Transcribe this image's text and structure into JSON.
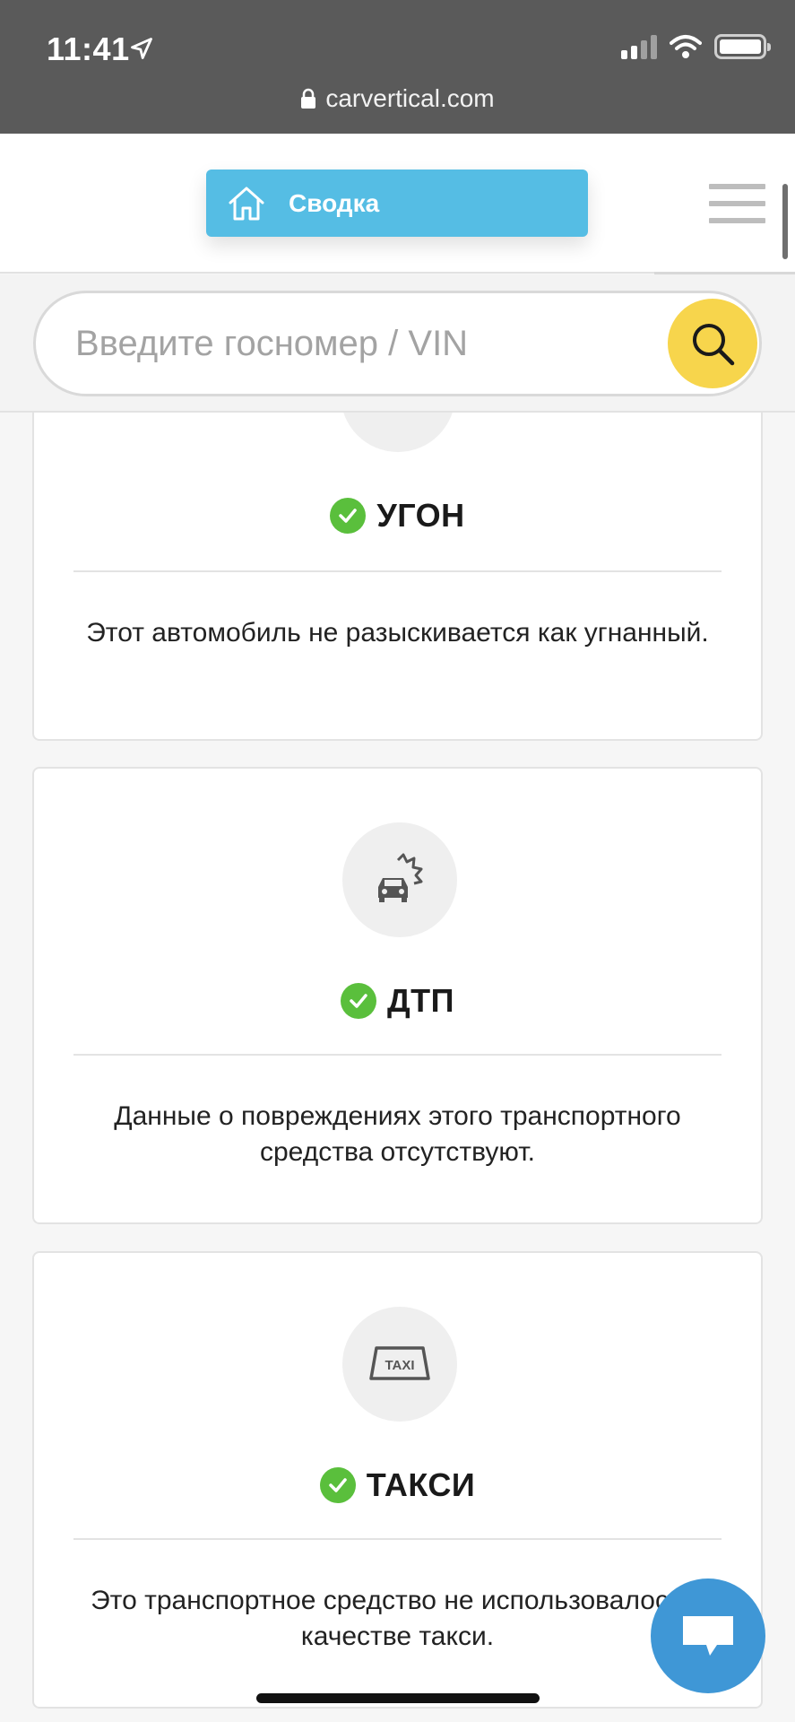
{
  "status_bar": {
    "time": "11:41",
    "url": "carvertical.com"
  },
  "header": {
    "summary_label": "Сводка"
  },
  "search": {
    "placeholder": "Введите госномер / VIN"
  },
  "cards": [
    {
      "title": "УГОН",
      "text": "Этот автомобиль не разыскивается как угнанный.",
      "icon": "theft-icon"
    },
    {
      "title": "ДТП",
      "text": "Данные о повреждениях этого транспортного средства отсутствуют.",
      "icon": "car-crash-icon"
    },
    {
      "title": "ТАКСИ",
      "text": "Это транспортное средство не использовалось в качестве такси.",
      "icon": "taxi-icon"
    }
  ],
  "colors": {
    "accent_blue": "#55bde4",
    "search_yellow": "#f7d54c",
    "check_green": "#5abf3c",
    "chat_blue": "#3f97d6"
  }
}
